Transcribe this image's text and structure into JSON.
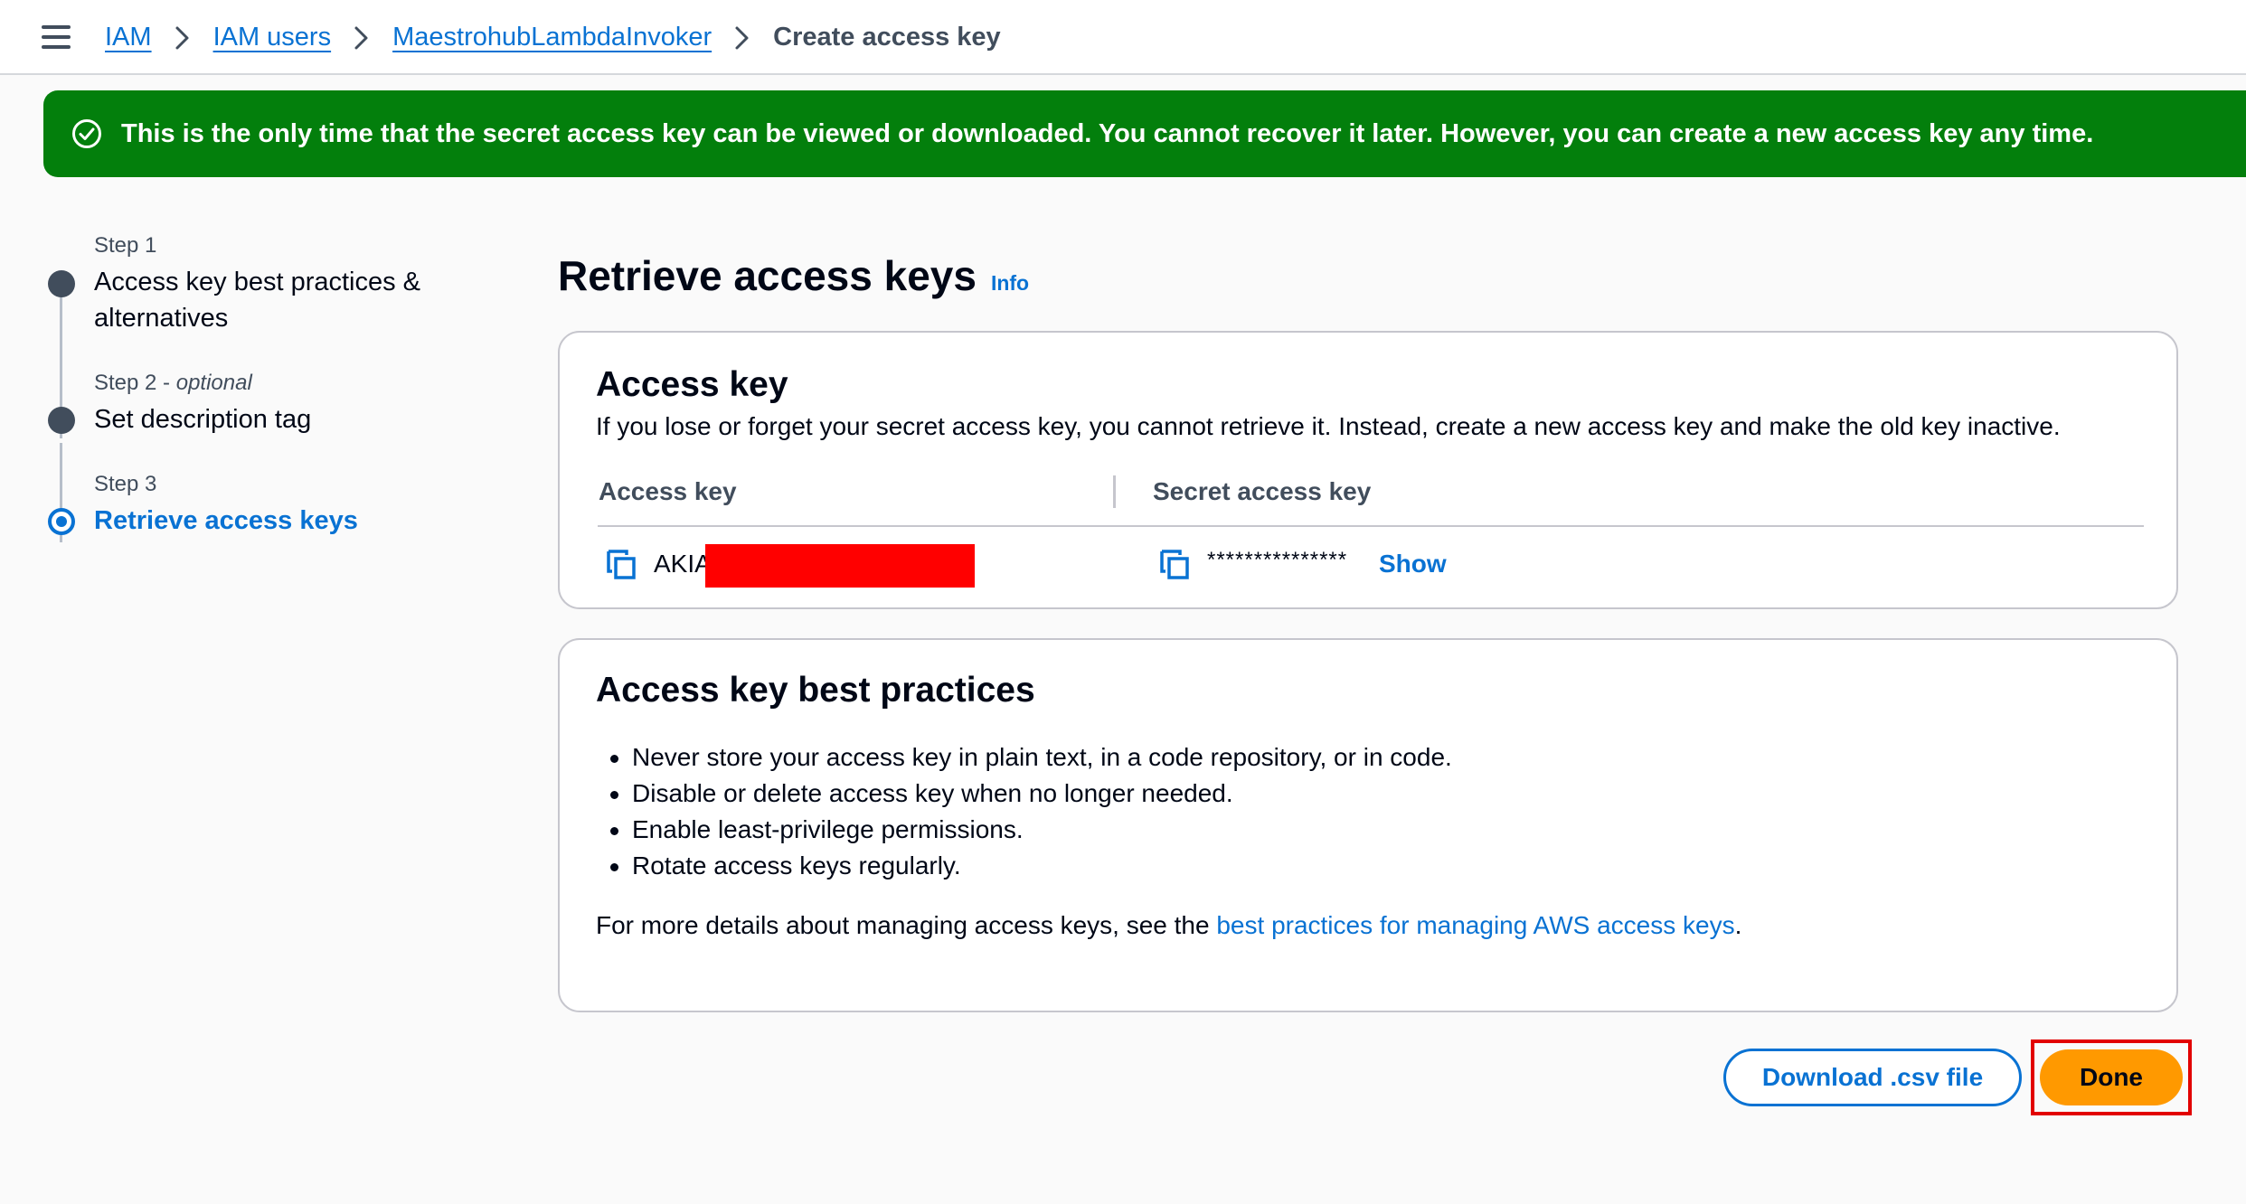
{
  "breadcrumb": {
    "items": [
      "IAM",
      "IAM users",
      "MaestrohubLambdaInvoker"
    ],
    "current": "Create access key"
  },
  "flash": {
    "message": "This is the only time that the secret access key can be viewed or downloaded. You cannot recover it later. However, you can create a new access key any time.",
    "color": "#037f0c"
  },
  "steps": [
    {
      "number": "Step 1",
      "optional": "",
      "title_line1": "Access key best practices &",
      "title_line2": "alternatives",
      "state": "completed"
    },
    {
      "number": "Step 2 - ",
      "optional": "optional",
      "title_line1": "Set description tag",
      "title_line2": "",
      "state": "completed"
    },
    {
      "number": "Step 3",
      "optional": "",
      "title_line1": "Retrieve access keys",
      "title_line2": "",
      "state": "active"
    }
  ],
  "page": {
    "title": "Retrieve access keys",
    "info_link": "Info"
  },
  "access_key_card": {
    "title": "Access key",
    "description": "If you lose or forget your secret access key, you cannot retrieve it. Instead, create a new access key and make the old key inactive.",
    "columns": [
      "Access key",
      "Secret access key"
    ],
    "access_key_prefix": "AKIA",
    "secret_masked": "***************",
    "show_label": "Show"
  },
  "best_practices_card": {
    "title": "Access key best practices",
    "items": [
      "Never store your access key in plain text, in a code repository, or in code.",
      "Disable or delete access key when no longer needed.",
      "Enable least-privilege permissions.",
      "Rotate access keys regularly."
    ],
    "footer_prefix": "For more details about managing access keys, see the ",
    "footer_link": "best practices for managing AWS access keys",
    "footer_suffix": "."
  },
  "actions": {
    "download_label": "Download .csv file",
    "done_label": "Done"
  },
  "colors": {
    "link": "#0972d3",
    "primary_button": "#ff9900",
    "highlight_outline": "#e20000",
    "redaction": "#ff0000"
  }
}
